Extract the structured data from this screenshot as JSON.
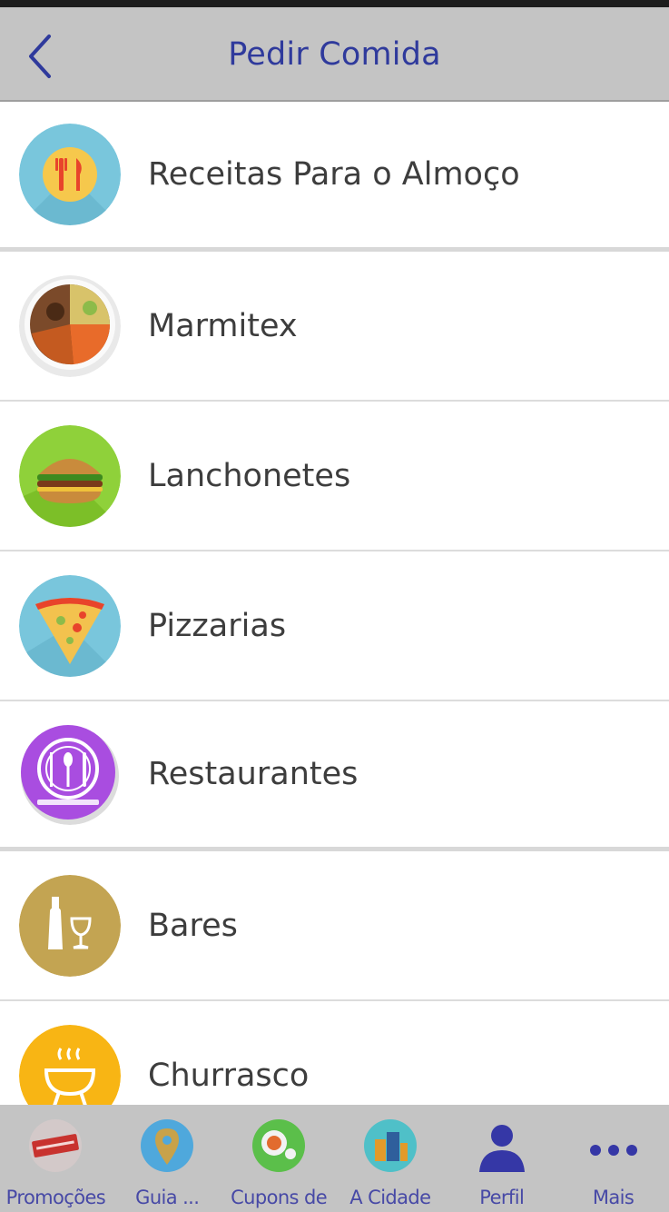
{
  "header": {
    "title": "Pedir Comida"
  },
  "items": [
    {
      "label": "Receitas Para o Almoço"
    },
    {
      "label": "Marmitex"
    },
    {
      "label": "Lanchonetes"
    },
    {
      "label": "Pizzarias"
    },
    {
      "label": "Restaurantes"
    },
    {
      "label": "Bares"
    },
    {
      "label": "Churrasco"
    }
  ],
  "tabs": [
    {
      "label": "Promoções"
    },
    {
      "label": "Guia ..."
    },
    {
      "label": "Cupons de"
    },
    {
      "label": "A Cidade"
    },
    {
      "label": "Perfil"
    },
    {
      "label": "Mais"
    }
  ],
  "colors": {
    "header_bg": "#c4c4c4",
    "accent": "#2f3a9c",
    "text": "#3d3d3d",
    "tabbar_bg": "#c4c4c4"
  },
  "icons": {
    "back": "chevron-left-icon",
    "items": [
      "cutlery-icon",
      "food-bowl-icon",
      "burger-icon",
      "pizza-icon",
      "restaurant-plate-icon",
      "wine-bottle-icon",
      "grill-icon"
    ],
    "tabs": [
      "promotion-icon",
      "map-pin-icon",
      "coupon-icon",
      "city-icon",
      "profile-icon",
      "more-dots-icon"
    ]
  }
}
